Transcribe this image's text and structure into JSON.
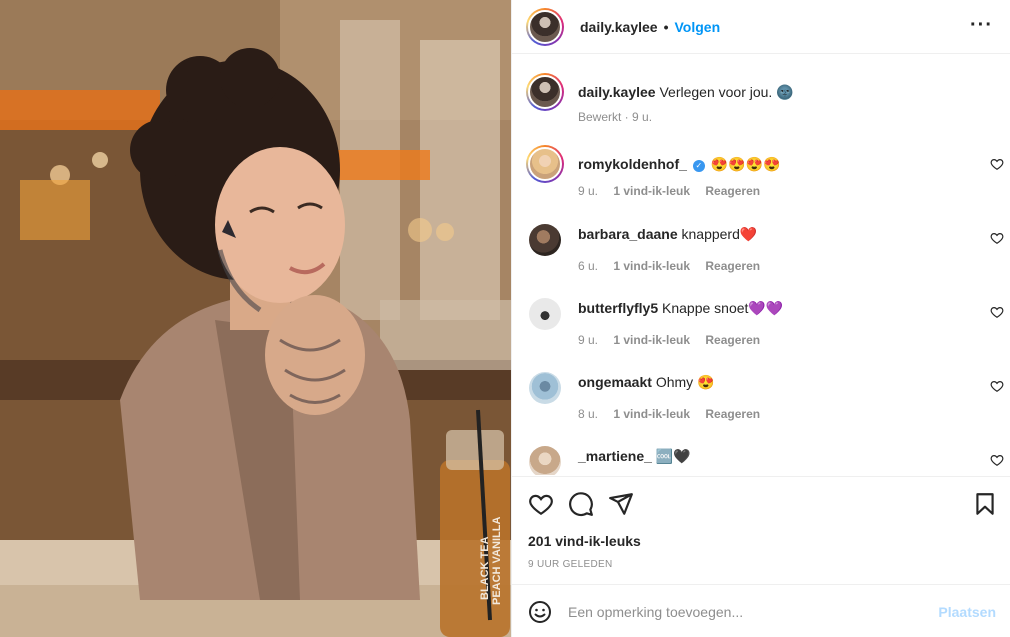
{
  "post": {
    "image_alt": "Woman with curly hair and tattoos smiling, resting chin on hands at a cafe table",
    "bottle_label_1": "BLACK TEA",
    "bottle_label_2": "PEACH VANILLA"
  },
  "header": {
    "username": "daily.kaylee",
    "separator": "•",
    "follow_label": "Volgen",
    "more_label": "···"
  },
  "caption": {
    "username": "daily.kaylee",
    "text": "Verlegen voor jou. 🌚",
    "edited": "Bewerkt · 9 u."
  },
  "comments": [
    {
      "username": "romykoldenhof_",
      "verified": "✓",
      "text": "😍😍😍😍",
      "time": "9 u.",
      "likes": "1 vind-ik-leuk",
      "reply": "Reageren"
    },
    {
      "username": "barbara_daane",
      "text": "knapperd❤️",
      "time": "6 u.",
      "likes": "1 vind-ik-leuk",
      "reply": "Reageren"
    },
    {
      "username": "butterflyfly5",
      "text": "Knappe snoet💜💜",
      "time": "9 u.",
      "likes": "1 vind-ik-leuk",
      "reply": "Reageren"
    },
    {
      "username": "ongemaakt",
      "text": "Ohmy 😍",
      "time": "8 u.",
      "likes": "1 vind-ik-leuk",
      "reply": "Reageren"
    },
    {
      "username": "_martiene_",
      "text": "🆒🖤",
      "time": "",
      "likes": "",
      "reply": ""
    }
  ],
  "actions": {
    "likes": "201 vind-ik-leuks",
    "posted": "9 UUR GELEDEN"
  },
  "add_comment": {
    "placeholder": "Een opmerking toevoegen...",
    "post_label": "Plaatsen"
  },
  "colors": {
    "accent": "#0095f6",
    "post_disabled": "#b3dbff",
    "meta_gray": "#8e8e8e",
    "text": "#262626",
    "heart_red": "#ed4956"
  }
}
